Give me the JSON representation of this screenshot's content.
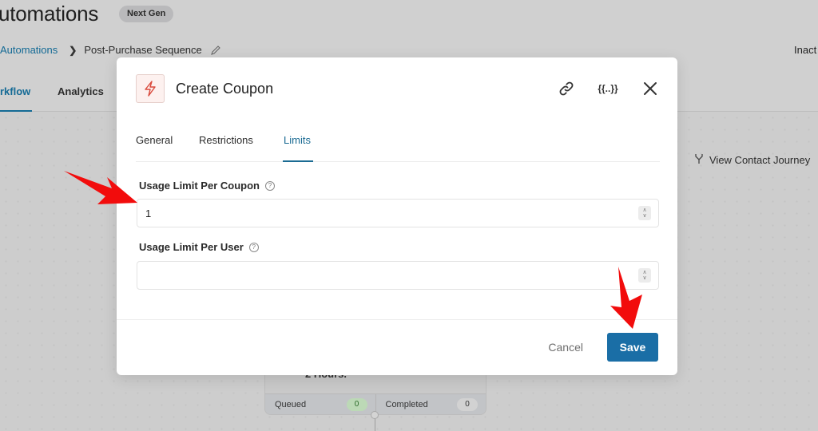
{
  "background": {
    "page_title": "utomations",
    "badge": "Next Gen",
    "breadcrumb": {
      "parent": "Automations",
      "current": "Post-Purchase Sequence"
    },
    "status": "Inact",
    "tabs": [
      {
        "label": "rkflow",
        "active": true
      },
      {
        "label": "Analytics",
        "active": false
      }
    ],
    "journey_link": "View Contact Journey",
    "node": {
      "text": "2 Hours.",
      "stats": [
        {
          "label": "Queued",
          "count": "0"
        },
        {
          "label": "Completed",
          "count": "0"
        }
      ]
    }
  },
  "modal": {
    "title": "Create Coupon",
    "icon": "lightning-bolt-icon",
    "header_icons": [
      "link-icon",
      "merge-tags-icon",
      "close-icon"
    ],
    "merge_tag_glyph": "{{..}}",
    "tabs": [
      {
        "label": "General",
        "active": false
      },
      {
        "label": "Restrictions",
        "active": false
      },
      {
        "label": "Limits",
        "active": true
      }
    ],
    "fields": [
      {
        "label": "Usage Limit Per Coupon",
        "value": "1",
        "placeholder": ""
      },
      {
        "label": "Usage Limit Per User",
        "value": "",
        "placeholder": ""
      }
    ],
    "help_glyph": "?",
    "footer": {
      "cancel_label": "Cancel",
      "save_label": "Save"
    }
  },
  "annotations": {
    "arrow_color": "#f20c0c",
    "arrows": [
      "pointing-to-usage-limit-per-coupon",
      "pointing-to-save-button"
    ]
  },
  "colors": {
    "accent": "#1a6ea6",
    "icon_red": "#d9493b"
  }
}
